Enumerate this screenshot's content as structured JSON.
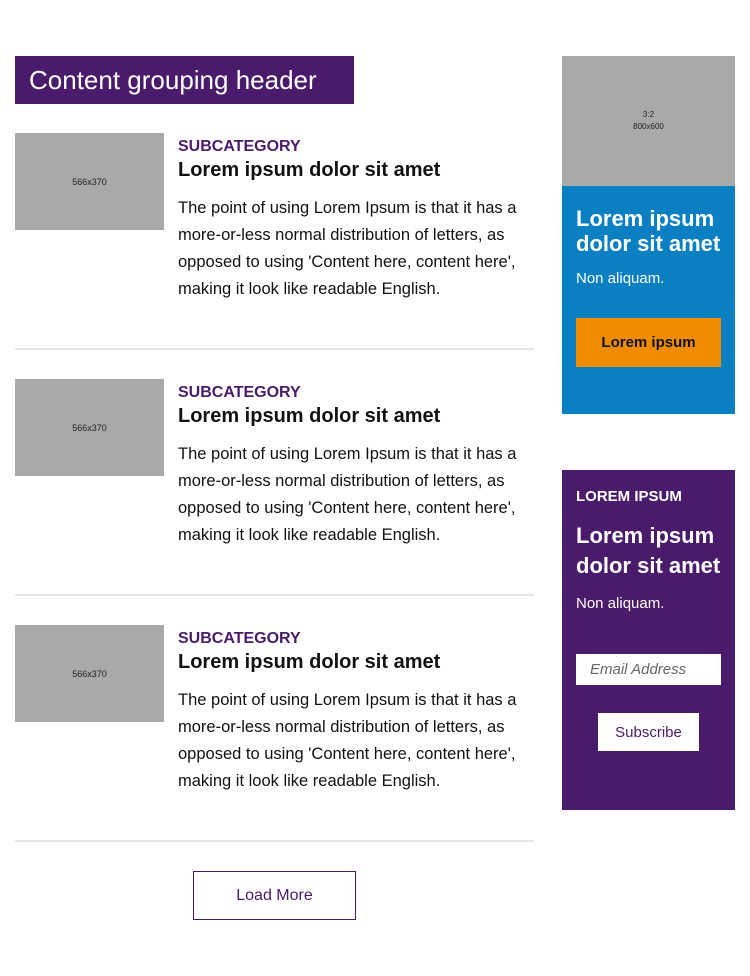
{
  "group_header": "Content grouping header",
  "articles": [
    {
      "thumb": "566x370",
      "subcategory": "SUBCATEGORY",
      "title": "Lorem ipsum dolor sit amet",
      "description": "The point of using Lorem Ipsum is that it has a more-or-less normal distribution of letters, as opposed to using 'Content here, content here', making it look like readable English."
    },
    {
      "thumb": "566x370",
      "subcategory": "SUBCATEGORY",
      "title": "Lorem ipsum dolor sit amet",
      "description": "The point of using Lorem Ipsum is that it has a more-or-less normal distribution of letters, as opposed to using 'Content here, content here', making it look like readable English."
    },
    {
      "thumb": "566x370",
      "subcategory": "SUBCATEGORY",
      "title": "Lorem ipsum dolor sit amet",
      "description": "The point of using Lorem Ipsum is that it has a more-or-less normal distribution of letters, as opposed to using 'Content here, content here', making it look like readable English."
    }
  ],
  "load_more": "Load More",
  "promo": {
    "image_ratio": "3:2",
    "image_size": "800x600",
    "title": "Lorem ipsum dolor sit amet",
    "subtitle": "Non aliquam.",
    "button": "Lorem ipsum"
  },
  "newsletter": {
    "eyebrow": "LOREM IPSUM",
    "title": "Lorem ipsum dolor sit amet",
    "subtitle": "Non aliquam.",
    "email_placeholder": "Email Address",
    "subscribe": "Subscribe"
  },
  "colors": {
    "brand_purple": "#4a1a6b",
    "promo_blue": "#0a7fc2",
    "cta_orange": "#f08c00",
    "placeholder_gray": "#a9a9a9"
  }
}
